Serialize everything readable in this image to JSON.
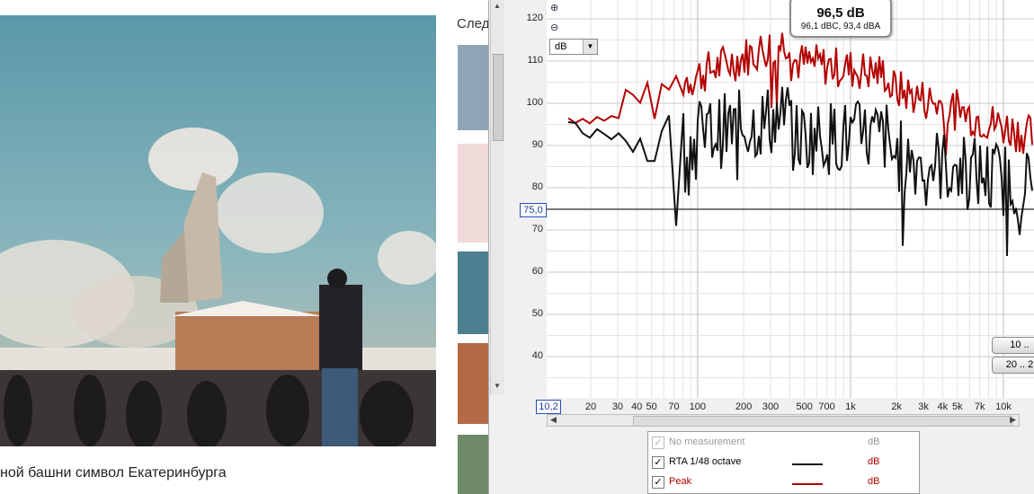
{
  "article": {
    "caption": "ной башни символ Екатеринбурга",
    "next_label": "След"
  },
  "rew": {
    "unit_select": "dB",
    "reference_value": "75,0",
    "x_min_value": "10,2",
    "readout": {
      "level": "96,5 dB",
      "weighted": "96,1 dBC, 93,4 dBA"
    },
    "range_buttons": [
      "10 ..",
      "20 .. 2"
    ],
    "y_axis": {
      "ticks": [
        "120",
        "110",
        "100",
        "90",
        "80",
        "70",
        "60",
        "50",
        "40"
      ]
    },
    "x_axis": {
      "ticks": [
        "20",
        "30",
        "40",
        "50",
        "70",
        "100",
        "200",
        "300",
        "500",
        "700",
        "1k",
        "2k",
        "3k",
        "4k",
        "5k",
        "7k",
        "10k"
      ]
    },
    "legend": [
      {
        "name": "No measurement",
        "checked": true,
        "disabled": true,
        "unit": "dB",
        "color": ""
      },
      {
        "name": "RTA 1/48 octave",
        "checked": true,
        "disabled": false,
        "unit": "dB",
        "color": "#111111"
      },
      {
        "name": "Peak",
        "checked": true,
        "disabled": false,
        "unit": "dB",
        "color": "#b40000"
      }
    ],
    "colors": {
      "rta": "#111111",
      "peak": "#b40000",
      "reference_line": "#000000"
    },
    "icons": [
      "zoom-in-icon",
      "zoom-out-icon"
    ]
  }
}
